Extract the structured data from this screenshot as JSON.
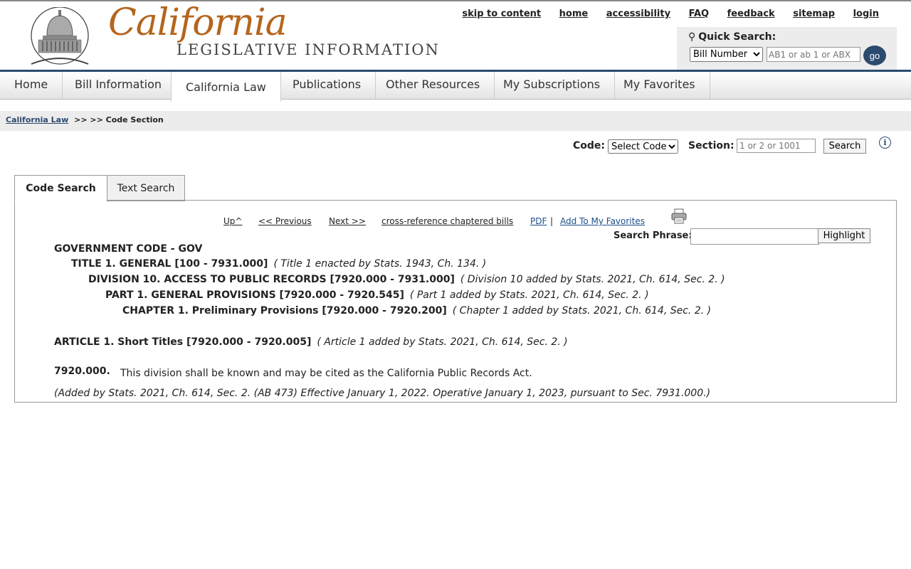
{
  "header": {
    "logo_script": "California",
    "logo_sub": "LEGISLATIVE INFORMATION",
    "links": [
      "skip to content",
      "home",
      "accessibility",
      "FAQ",
      "feedback",
      "sitemap",
      "login"
    ]
  },
  "quick_search": {
    "title": "Quick Search:",
    "select_value": "Bill Number",
    "input_placeholder": "AB1 or ab 1 or ABX",
    "go_label": "go"
  },
  "nav": {
    "items": [
      "Home",
      "Bill Information",
      "California Law",
      "Publications",
      "Other Resources",
      "My Subscriptions",
      "My Favorites"
    ],
    "active": "California Law"
  },
  "breadcrumb": {
    "link": "California Law",
    "rest": ">> >> Code Section"
  },
  "code_bar": {
    "code_label": "Code:",
    "code_select": "Select Code",
    "section_label": "Section:",
    "section_placeholder": "1 or 2 or 1001",
    "search_label": "Search",
    "info_glyph": "i"
  },
  "tabs": [
    "Code Search",
    "Text Search"
  ],
  "panel": {
    "nav": {
      "up": "Up^",
      "previous": "<< Previous",
      "next": "Next >>",
      "cross_ref": "cross-reference chaptered bills",
      "pdf": "PDF",
      "separator": "|",
      "favorites": "Add To My Favorites"
    },
    "search_phrase_label": "Search Phrase:",
    "highlight_label": "Highlight",
    "hierarchy": [
      {
        "title": "GOVERNMENT CODE - GOV",
        "note": ""
      },
      {
        "title": "TITLE 1. GENERAL [100 - 7931.000]",
        "note": "( Title 1 enacted by Stats. 1943, Ch. 134. )"
      },
      {
        "title": "DIVISION 10. ACCESS TO PUBLIC RECORDS [7920.000 - 7931.000]",
        "note": "( Division 10 added by Stats. 2021, Ch. 614, Sec. 2. )"
      },
      {
        "title": "PART 1. GENERAL PROVISIONS [7920.000 - 7920.545]",
        "note": "( Part 1 added by Stats. 2021, Ch. 614, Sec. 2. )"
      },
      {
        "title": "CHAPTER 1. Preliminary Provisions [7920.000 - 7920.200]",
        "note": "( Chapter 1 added by Stats. 2021, Ch. 614, Sec. 2. )"
      }
    ],
    "article": {
      "title": "ARTICLE 1. Short Titles [7920.000 - 7920.005]",
      "note": "( Article 1 added by Stats. 2021, Ch. 614, Sec. 2. )"
    },
    "section_number": "7920.000.",
    "section_text": "This division shall be known and may be cited as the California Public Records Act.",
    "history": "(Added by Stats. 2021, Ch. 614, Sec. 2. (AB 473) Effective January 1, 2022. Operative January 1, 2023, pursuant to Sec. 7931.000.)"
  },
  "colors": {
    "navy": "#2c4a6e",
    "logo_orange": "#b5651d"
  }
}
